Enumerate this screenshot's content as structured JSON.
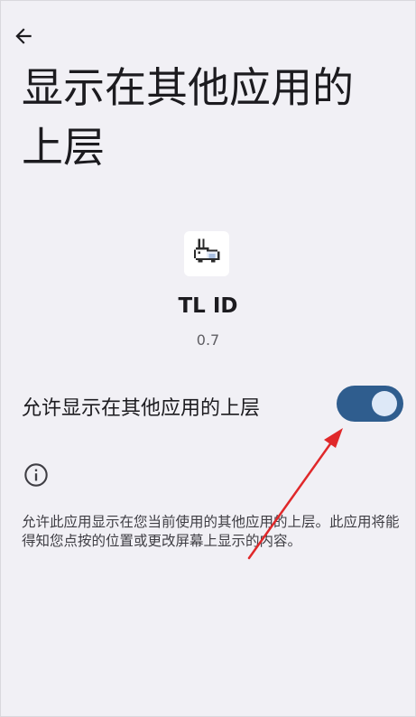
{
  "header": {
    "back_icon": "arrow-back-icon",
    "title": "显示在其他应用的上层"
  },
  "app": {
    "icon": "rabbit-icon",
    "name": "TL ID",
    "version": "0.7"
  },
  "permission": {
    "toggle_label": "允许显示在其他应用的上层",
    "toggle_state": "on",
    "switch_color": "#2f5d8e",
    "info_icon": "info-icon",
    "description": "允许此应用显示在您当前使用的其他应用的上层。此应用将能得知您点按的位置或更改屏幕上显示的内容。"
  },
  "annotation": {
    "type": "red-arrow",
    "color": "#e0282a"
  }
}
